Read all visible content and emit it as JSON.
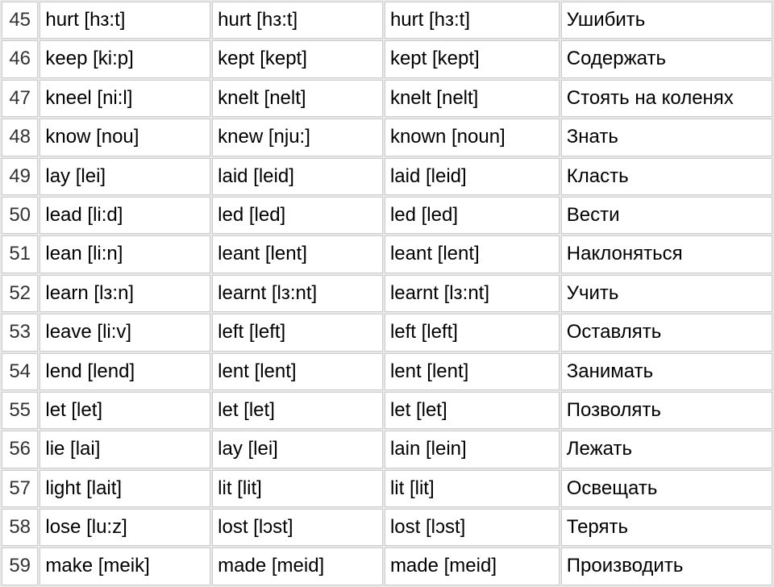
{
  "rows": [
    {
      "num": "45",
      "base": "hurt [hз:t]",
      "past": "hurt [hз:t]",
      "pp": "hurt [hз:t]",
      "trans": "Ушибить"
    },
    {
      "num": "46",
      "base": "keep [ki:p]",
      "past": "kept [kept]",
      "pp": "kept [kept]",
      "trans": "Содержать"
    },
    {
      "num": "47",
      "base": "kneel [ni:l]",
      "past": "knelt [nelt]",
      "pp": "knelt [nelt]",
      "trans": "Стоять на коленях"
    },
    {
      "num": "48",
      "base": "know [nou]",
      "past": "knew [nju:]",
      "pp": "known [noun]",
      "trans": "Знать"
    },
    {
      "num": "49",
      "base": "lay [lei]",
      "past": "laid [leid]",
      "pp": "laid [leid]",
      "trans": "Класть"
    },
    {
      "num": "50",
      "base": "lead [li:d]",
      "past": "led [led]",
      "pp": "led [led]",
      "trans": "Вести"
    },
    {
      "num": "51",
      "base": "lean [li:n]",
      "past": "leant [lent]",
      "pp": "leant [lent]",
      "trans": "Наклоняться"
    },
    {
      "num": "52",
      "base": "learn [lз:n]",
      "past": "learnt [lз:nt]",
      "pp": "learnt [lз:nt]",
      "trans": "Учить"
    },
    {
      "num": "53",
      "base": "leave [li:v]",
      "past": "left [left]",
      "pp": "left [left]",
      "trans": "Оставлять"
    },
    {
      "num": "54",
      "base": "lend [lend]",
      "past": "lent [lent]",
      "pp": "lent [lent]",
      "trans": "Занимать"
    },
    {
      "num": "55",
      "base": "let [let]",
      "past": "let [let]",
      "pp": "let [let]",
      "trans": "Позволять"
    },
    {
      "num": "56",
      "base": "lie [lai]",
      "past": "lay [lei]",
      "pp": "lain [lein]",
      "trans": "Лежать"
    },
    {
      "num": "57",
      "base": "light [lait]",
      "past": "lit [lit]",
      "pp": "lit [lit]",
      "trans": "Освещать"
    },
    {
      "num": "58",
      "base": "lose [lu:z]",
      "past": "lost [lɔst]",
      "pp": "lost [lɔst]",
      "trans": "Терять"
    },
    {
      "num": "59",
      "base": "make [meik]",
      "past": "made [meid]",
      "pp": "made [meid]",
      "trans": "Производить"
    }
  ]
}
